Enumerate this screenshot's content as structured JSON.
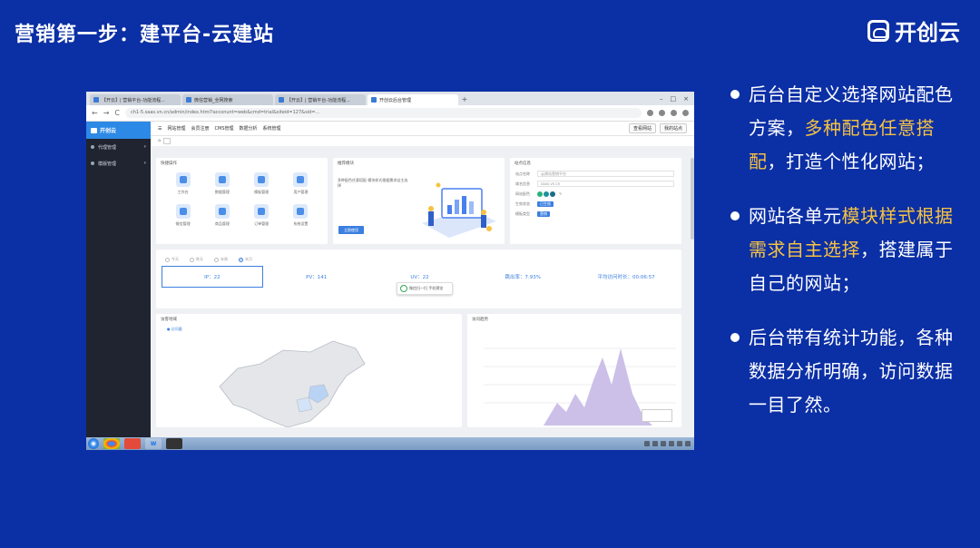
{
  "slide": {
    "title": "营销第一步：建平台-云建站",
    "brand": "开创云"
  },
  "browser": {
    "tabs": [
      "【开云】| 营销平台-功能流程...",
      "微信营销_全网搜索",
      "【开云】| 营销平台-功能流程...",
      "开创云后台管理"
    ],
    "new_tab": "+",
    "url": "ch1-5.saas.vn.cn/admin/index.html?acconunt=web&cmd=trial&siteid=127&sid=...",
    "back": "←",
    "forward": "→",
    "reload": "C"
  },
  "app": {
    "logo": "开创云",
    "sidebar": [
      "代理管理",
      "模版管理"
    ],
    "topnav": [
      "网站管理",
      "会员注册",
      "CMS管理",
      "数据分析",
      "系统管理"
    ],
    "topnav_right": [
      "查看网站",
      "我的站点"
    ],
    "quick_title": "快捷操作",
    "quick_items": [
      "工作台",
      "数据管理",
      "模板管理",
      "用户管理",
      "微信管理",
      "商品管理",
      "订单管理",
      "系统设置"
    ],
    "promo_title": "推荐模块",
    "promo_text": "多种配色任意搭配 模块样式根据需求自主选择",
    "promo_button": "立即使用",
    "site_title": "站点信息",
    "site_rows": [
      {
        "label": "站点名称",
        "value": "云建站营销平台"
      },
      {
        "label": "域名信息",
        "value": "saas.vn.cn"
      },
      {
        "label": "网站配色",
        "value": ""
      },
      {
        "label": "生效状态",
        "value": "已生效"
      },
      {
        "label": "模板类型",
        "value": "营销"
      }
    ],
    "radios": [
      "今天",
      "昨天",
      "本周",
      "本月"
    ],
    "metrics": [
      "IP：22",
      "PV：141",
      "UV：22",
      "跳出率：7.93%",
      "平均访问时长：00:06:57"
    ],
    "tooltip": "微信扫一扫 手机预览",
    "map_title": "访客地域",
    "map_legend": "访问量",
    "trend_title": "访问趋势"
  },
  "colors": {
    "slide_bg": "#0b2fa5",
    "highlight": "#f5c243",
    "accent": "#3b7fe0"
  },
  "bullets": [
    {
      "parts": [
        {
          "text": "后台自定义选择网站配色方案，",
          "hl": false
        },
        {
          "text": "多种配色任意搭配",
          "hl": true
        },
        {
          "text": "，打造个性化网站；",
          "hl": false
        }
      ]
    },
    {
      "parts": [
        {
          "text": "网站各单元",
          "hl": false
        },
        {
          "text": "模块样式根据需求自主选择",
          "hl": true
        },
        {
          "text": "，搭建属于自己的网站；",
          "hl": false
        }
      ]
    },
    {
      "parts": [
        {
          "text": "后台带有统计功能，各种数据分析明确，访问数据一目了然。",
          "hl": false
        }
      ]
    }
  ]
}
